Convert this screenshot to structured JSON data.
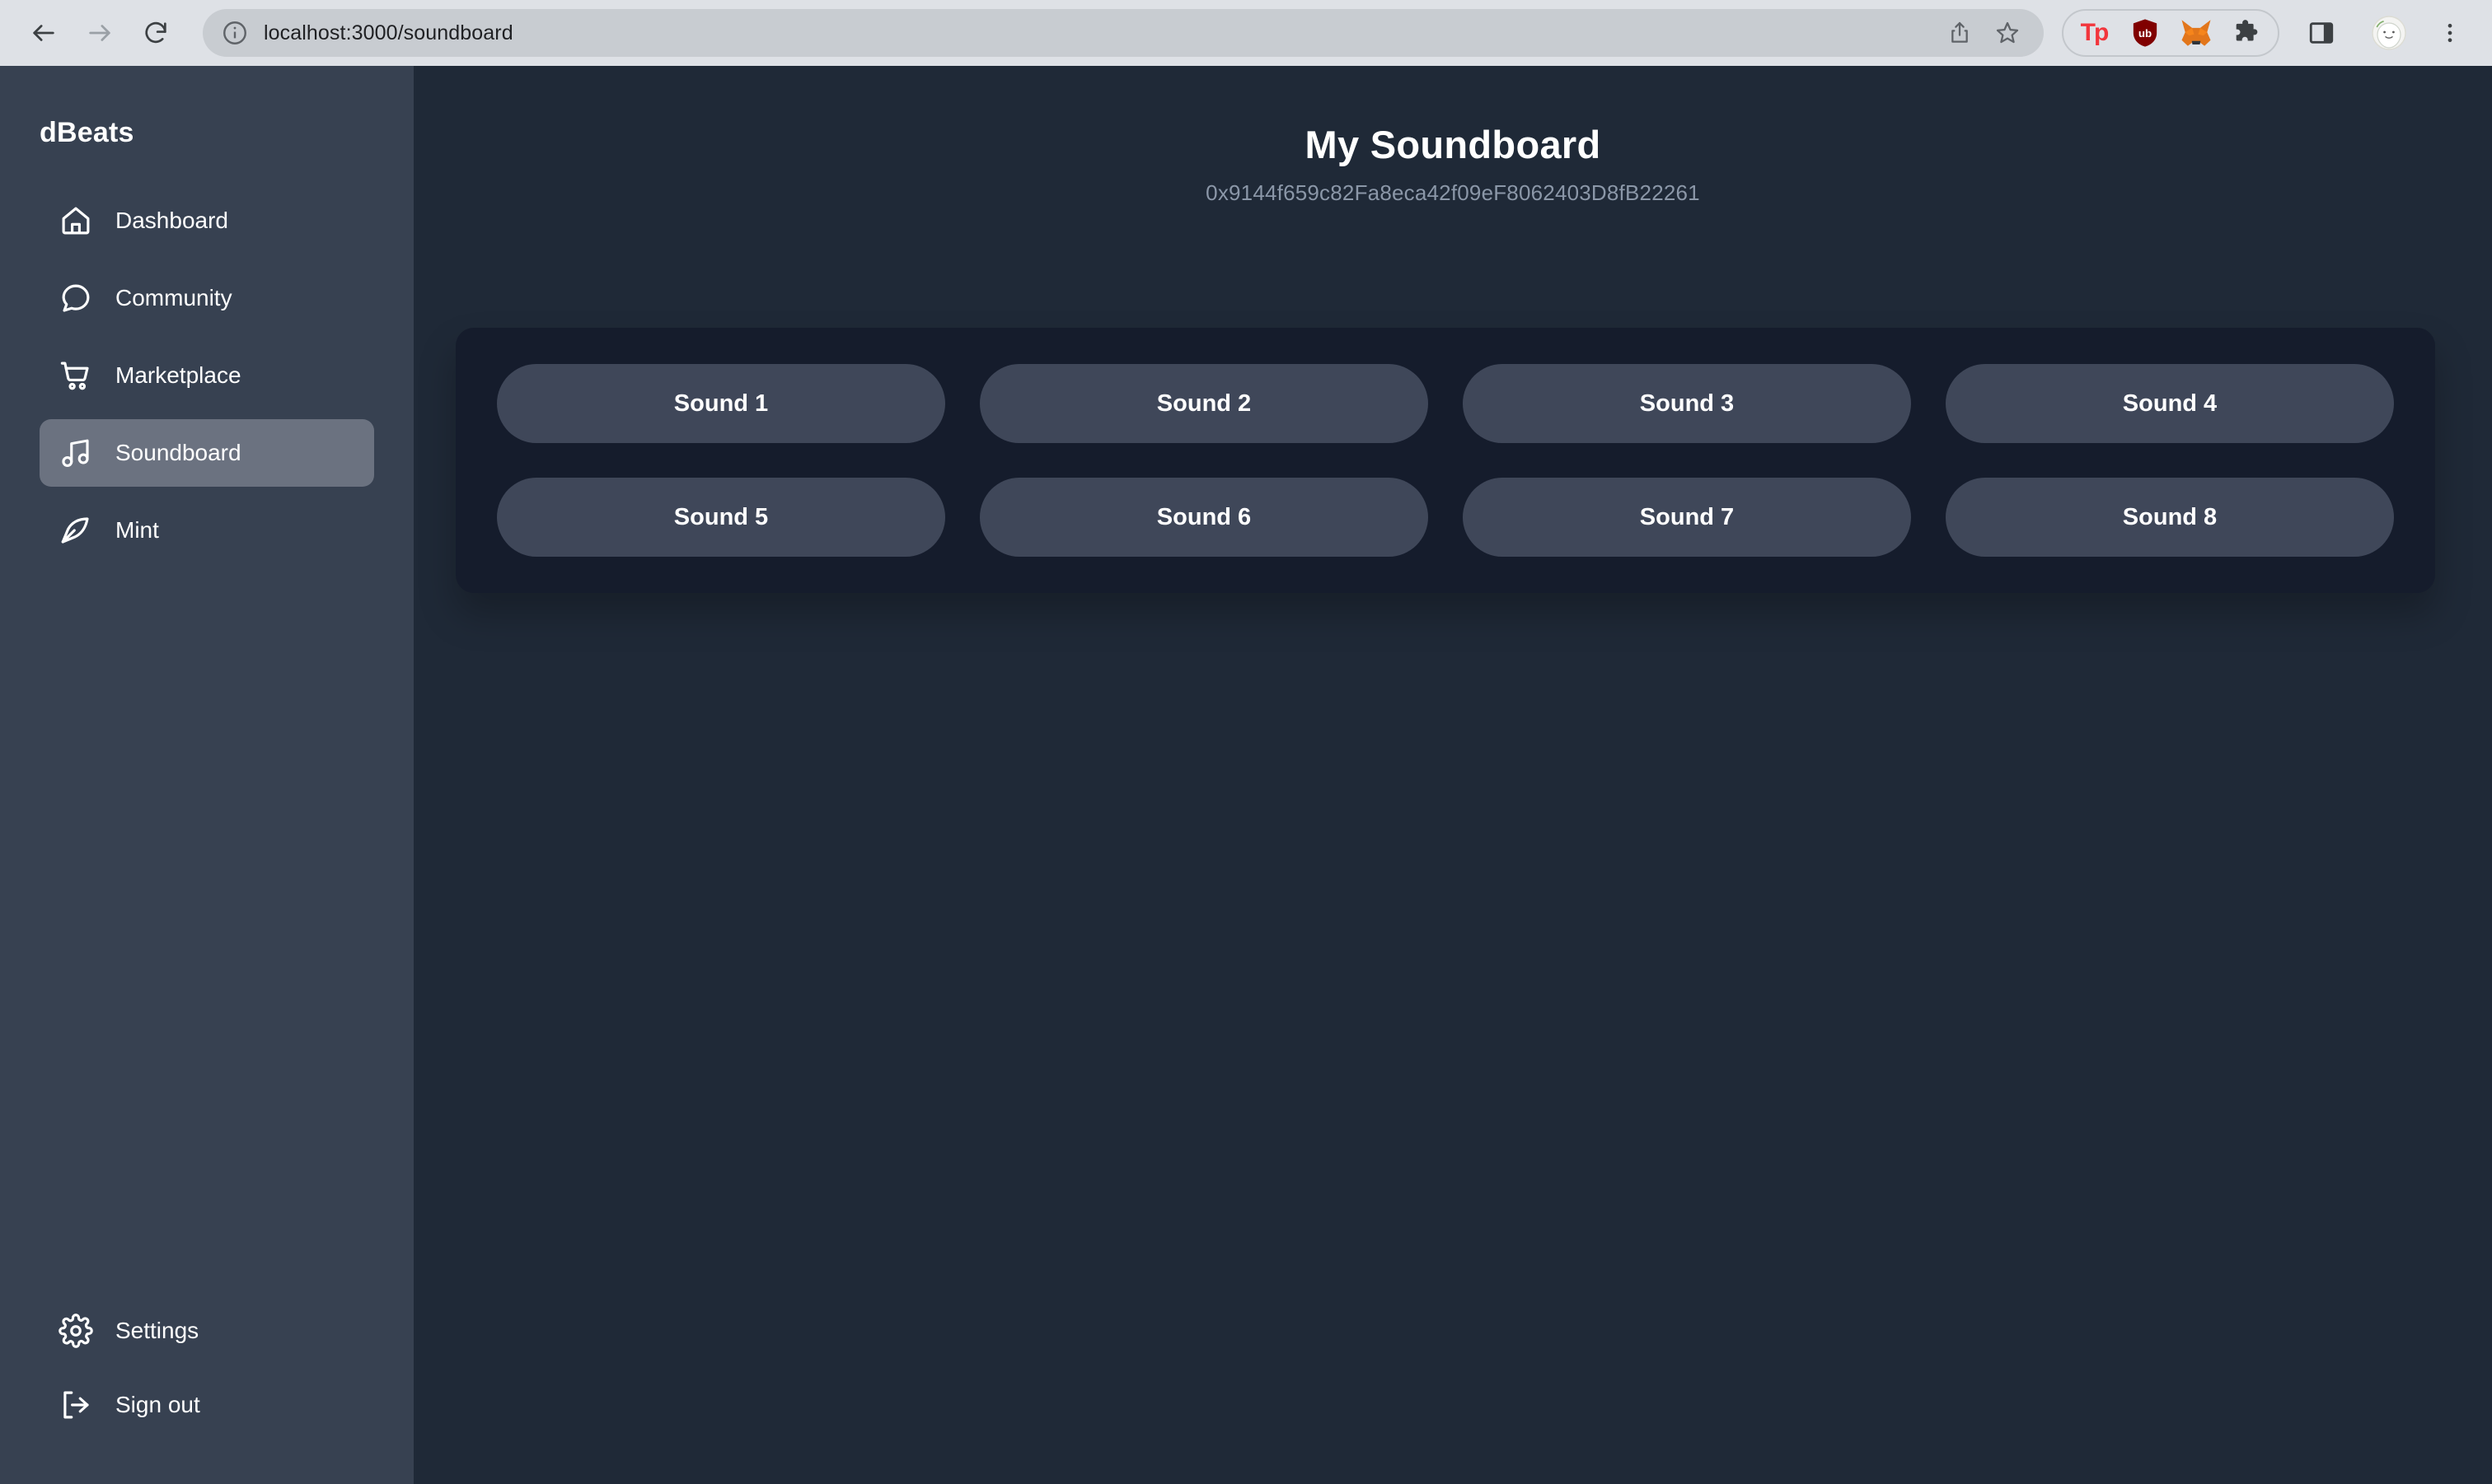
{
  "browser": {
    "back_icon": "arrow-left-icon",
    "forward_icon": "arrow-right-icon",
    "reload_icon": "reload-icon",
    "site_info_icon": "info-circle-icon",
    "url": "localhost:3000/soundboard",
    "share_icon": "share-icon",
    "bookmark_icon": "star-icon",
    "extensions": [
      {
        "name": "tp-extension",
        "label": "Tp"
      },
      {
        "name": "ublock-origin-extension",
        "label": "ub"
      },
      {
        "name": "metamask-extension",
        "label": ""
      },
      {
        "name": "extensions-puzzle-icon",
        "label": ""
      }
    ],
    "side_panel_icon": "side-panel-icon",
    "profile_icon": "profile-avatar-icon",
    "menu_icon": "three-dot-menu-icon"
  },
  "sidebar": {
    "brand": "dBeats",
    "items": [
      {
        "label": "Dashboard",
        "icon": "home-icon",
        "active": false
      },
      {
        "label": "Community",
        "icon": "chat-bubble-icon",
        "active": false
      },
      {
        "label": "Marketplace",
        "icon": "shopping-cart-icon",
        "active": false
      },
      {
        "label": "Soundboard",
        "icon": "music-note-icon",
        "active": true
      },
      {
        "label": "Mint",
        "icon": "feather-pen-icon",
        "active": false
      }
    ],
    "bottom_items": [
      {
        "label": "Settings",
        "icon": "gear-icon"
      },
      {
        "label": "Sign out",
        "icon": "sign-out-icon"
      }
    ]
  },
  "main": {
    "title": "My Soundboard",
    "wallet_address": "0x9144f659c82Fa8eca42f09eF8062403D8fB22261",
    "sounds": [
      {
        "label": "Sound 1"
      },
      {
        "label": "Sound 2"
      },
      {
        "label": "Sound 3"
      },
      {
        "label": "Sound 4"
      },
      {
        "label": "Sound 5"
      },
      {
        "label": "Sound 6"
      },
      {
        "label": "Sound 7"
      },
      {
        "label": "Sound 8"
      }
    ]
  },
  "colors": {
    "sidebar_bg": "#374151",
    "main_bg": "#1f2937",
    "panel_bg": "#151c2c",
    "button_bg": "#3f4759",
    "active_item_bg": "#6b7280",
    "wallet_text": "#8b97a8"
  }
}
